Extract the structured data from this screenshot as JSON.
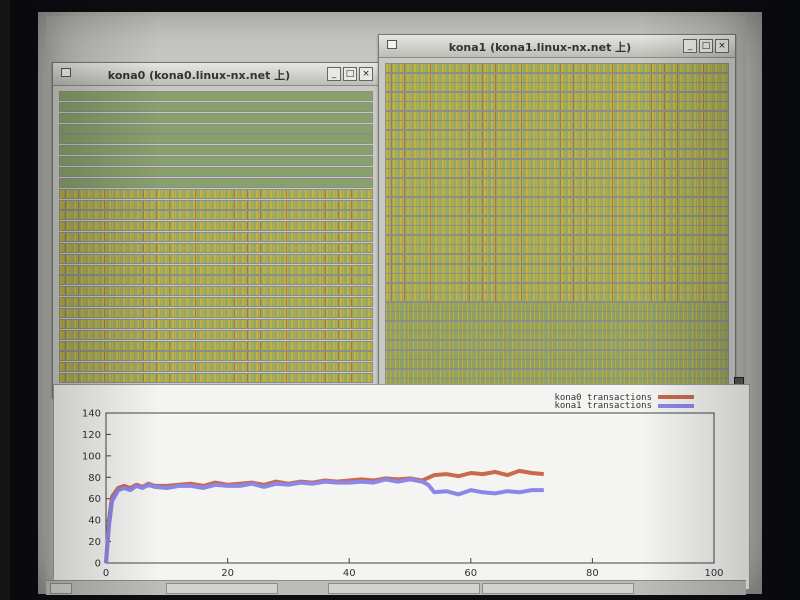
{
  "kona0_window": {
    "title": "kona0 (kona0.linux-nx.net 上)",
    "rows": [
      "idle",
      "idle",
      "idle",
      "idle",
      "idle",
      "idle",
      "idle",
      "idle",
      "idle",
      "busy",
      "busy",
      "busy",
      "busy",
      "busy",
      "busy",
      "busy",
      "busy",
      "busy",
      "busy",
      "busy",
      "busy",
      "busy",
      "busy",
      "busy",
      "busy",
      "busy",
      "busy",
      "busy"
    ]
  },
  "kona1_window": {
    "title": "kona1 (kona1.linux-nx.net 上)",
    "rows": [
      "busy",
      "busy",
      "busy",
      "busy",
      "busy",
      "busy",
      "busy",
      "busy",
      "busy",
      "busy",
      "busy",
      "busy",
      "busy",
      "busy",
      "busy",
      "busy",
      "busy",
      "busy",
      "busy",
      "busy",
      "busy",
      "busy",
      "busy",
      "busy",
      "busy",
      "spec",
      "spec",
      "spec",
      "spec",
      "spec",
      "spec",
      "spec",
      "spec",
      "spec"
    ]
  },
  "window_buttons": {
    "minimize": "_",
    "maximize": "□",
    "close": "×"
  },
  "colors": {
    "kona0_line": "#c96a4c",
    "kona1_line": "#8c86e8",
    "idle_row": "#88a06a",
    "busy_row": "#c8b03e"
  },
  "chart_data": {
    "type": "line",
    "xlim": [
      0,
      100
    ],
    "ylim": [
      0,
      140
    ],
    "xticks": [
      "0",
      "20",
      "40",
      "60",
      "80",
      "100"
    ],
    "yticks": [
      "0",
      "20",
      "40",
      "60",
      "80",
      "100",
      "120",
      "140"
    ],
    "legend_position": "top-right",
    "series": [
      {
        "name": "kona0 transactions",
        "x": [
          0,
          0.5,
          1,
          2,
          3,
          4,
          5,
          6,
          7,
          8,
          10,
          12,
          14,
          16,
          18,
          20,
          22,
          24,
          26,
          28,
          30,
          32,
          34,
          36,
          38,
          40,
          42,
          44,
          46,
          48,
          50,
          52,
          54,
          56,
          58,
          60,
          62,
          64,
          66,
          68,
          70,
          72
        ],
        "y": [
          0,
          40,
          62,
          70,
          72,
          70,
          73,
          71,
          74,
          72,
          72,
          73,
          74,
          72,
          75,
          73,
          74,
          75,
          73,
          76,
          74,
          76,
          75,
          77,
          76,
          77,
          78,
          77,
          79,
          78,
          79,
          77,
          82,
          83,
          81,
          84,
          83,
          85,
          82,
          86,
          84,
          83
        ]
      },
      {
        "name": "kona1 transactions",
        "x": [
          0,
          0.5,
          1,
          2,
          3,
          4,
          5,
          6,
          7,
          8,
          10,
          12,
          14,
          16,
          18,
          20,
          22,
          24,
          26,
          28,
          30,
          32,
          34,
          36,
          38,
          40,
          42,
          44,
          46,
          48,
          50,
          52,
          53,
          54,
          56,
          58,
          60,
          62,
          64,
          66,
          68,
          70,
          72
        ],
        "y": [
          0,
          35,
          58,
          68,
          70,
          68,
          72,
          70,
          73,
          71,
          70,
          72,
          72,
          70,
          73,
          72,
          72,
          74,
          71,
          74,
          73,
          75,
          74,
          76,
          75,
          75,
          76,
          75,
          78,
          76,
          78,
          76,
          73,
          66,
          67,
          64,
          68,
          66,
          65,
          67,
          66,
          68,
          68
        ]
      }
    ]
  }
}
